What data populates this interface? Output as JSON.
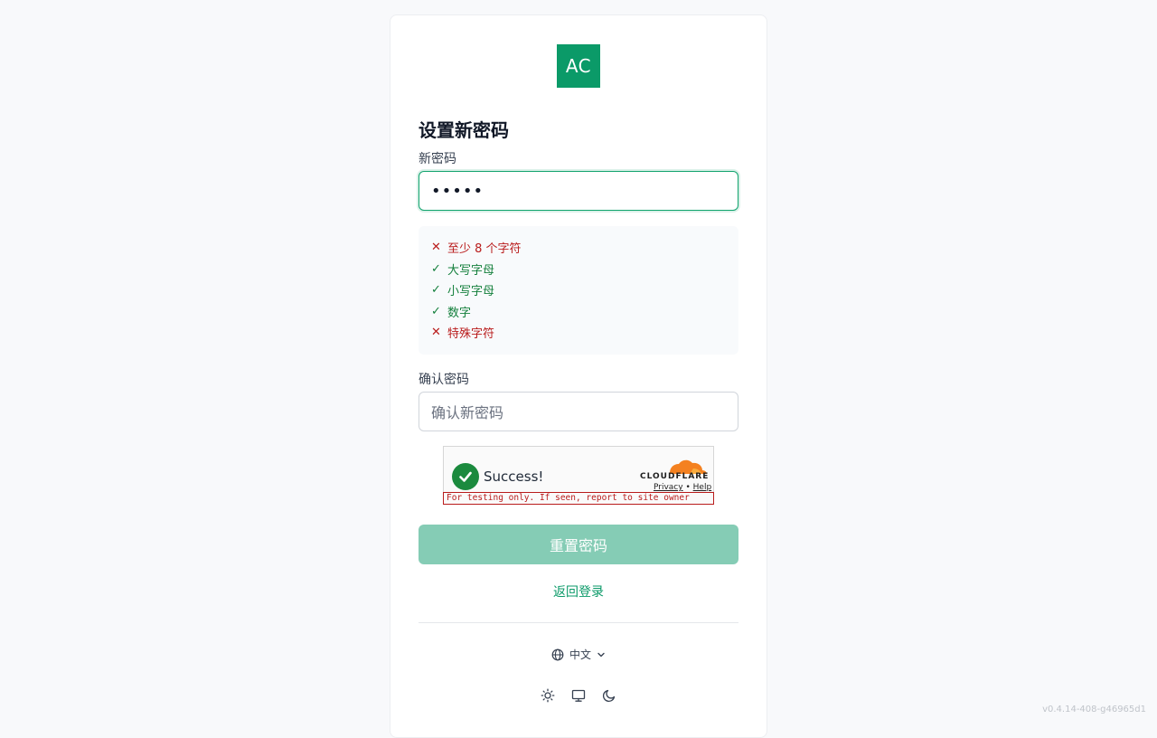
{
  "logo": {
    "text": "AC",
    "color": "#0b9a68"
  },
  "title": "设置新密码",
  "new_password": {
    "label": "新密码",
    "value": "•••••"
  },
  "requirements": [
    {
      "text": "至少 8 个字符",
      "status": "fail"
    },
    {
      "text": "大写字母",
      "status": "ok"
    },
    {
      "text": "小写字母",
      "status": "ok"
    },
    {
      "text": "数字",
      "status": "ok"
    },
    {
      "text": "特殊字符",
      "status": "fail"
    }
  ],
  "confirm_password": {
    "label": "确认密码",
    "placeholder": "确认新密码"
  },
  "turnstile": {
    "status": "Success!",
    "brand": "CLOUDFLARE",
    "privacy": "Privacy",
    "separator": "•",
    "help": "Help",
    "warning": "For testing only. If seen, report to site owner"
  },
  "submit_label": "重置密码",
  "back_label": "返回登录",
  "language": {
    "icon": "globe-icon",
    "value": "中文"
  },
  "theme_icons": [
    "sun-icon",
    "monitor-icon",
    "moon-icon"
  ],
  "version": "v0.4.14-408-g46965d1",
  "colors": {
    "accent": "#0b9a68",
    "button_disabled": "#85ccb5",
    "fail": "#b91c1c",
    "ok": "#15803d"
  }
}
